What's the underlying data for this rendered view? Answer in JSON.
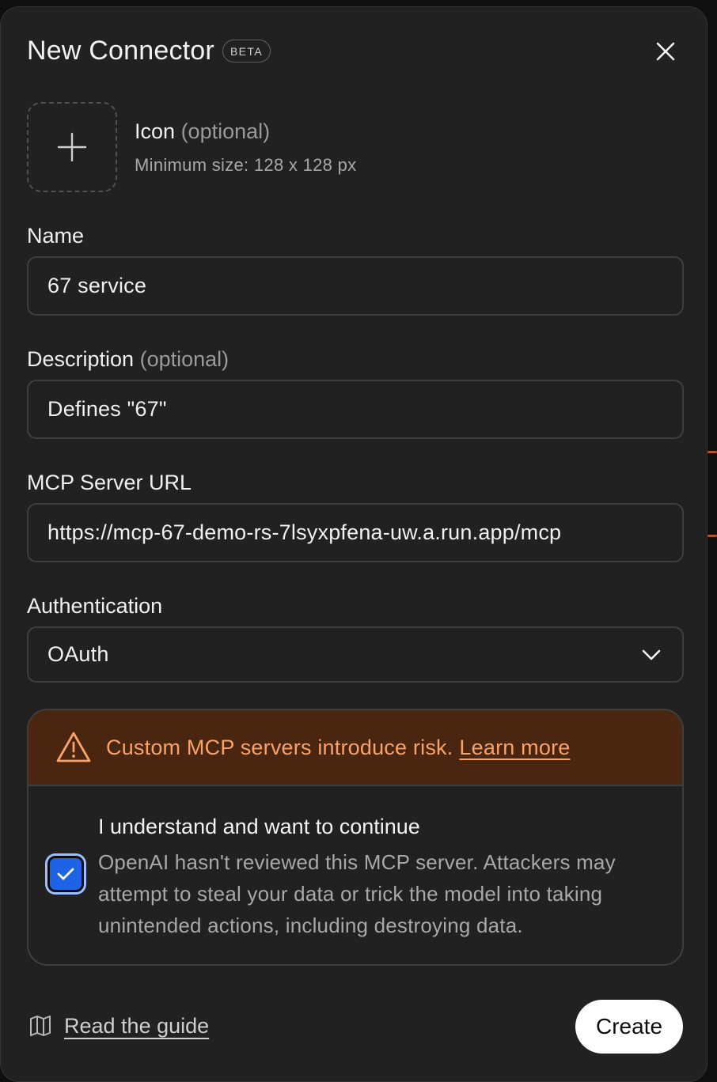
{
  "header": {
    "title": "New Connector",
    "badge": "BETA"
  },
  "icon_section": {
    "label": "Icon",
    "optional": "(optional)",
    "hint": "Minimum size: 128 x 128 px"
  },
  "fields": {
    "name": {
      "label": "Name",
      "value": "67 service"
    },
    "description": {
      "label": "Description",
      "optional": "(optional)",
      "value": "Defines \"67\""
    },
    "url": {
      "label": "MCP Server URL",
      "value": "https://mcp-67-demo-rs-7lsyxpfena-uw.a.run.app/mcp"
    },
    "auth": {
      "label": "Authentication",
      "value": "OAuth"
    }
  },
  "warning": {
    "text": "Custom MCP servers introduce risk.",
    "link": "Learn more",
    "ack_title": "I understand and want to continue",
    "ack_desc": "OpenAI hasn't reviewed this MCP server. Attackers may attempt to steal your data or trick the model into taking unintended actions, including destroying data.",
    "checked": true
  },
  "footer": {
    "guide": "Read the guide",
    "create": "Create"
  },
  "colors": {
    "background": "#212121",
    "warning_bg": "#4a2611",
    "warning_text": "#f7a36a",
    "checkbox": "#1e63e6"
  },
  "icons": [
    "close-icon",
    "plus-icon",
    "warning-triangle-icon",
    "check-icon",
    "chevron-down-icon",
    "book-icon"
  ]
}
